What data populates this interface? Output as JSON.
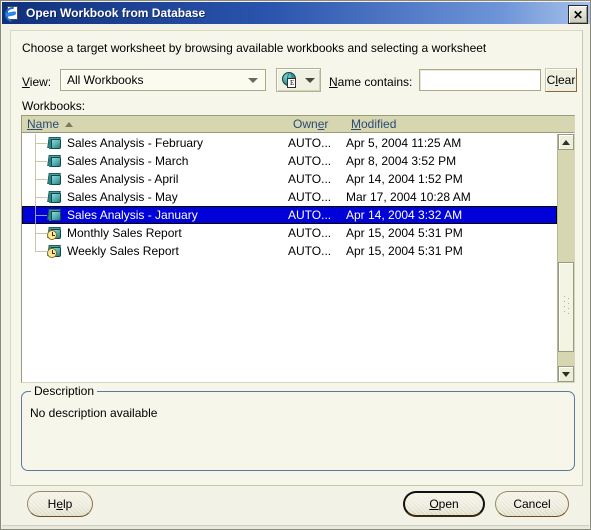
{
  "window": {
    "title": "Open Workbook from Database",
    "icon": "workbook-document-icon",
    "close_label": "✕"
  },
  "instruction": "Choose a target worksheet by browsing available workbooks and selecting a worksheet",
  "filters": {
    "view_label_pre": "V",
    "view_label_post": "iew:",
    "view_value": "All Workbooks",
    "source_button_icon": "globe-document-icon",
    "name_label_pre": "N",
    "name_label_post": "ame contains:",
    "name_value": "",
    "name_placeholder": "",
    "clear_label_pre": "C",
    "clear_label_mid": "l",
    "clear_label_post": "ear"
  },
  "list": {
    "section_label": "Workbooks:",
    "columns": [
      {
        "key": "name",
        "label_pre": "N",
        "label_mn": "a",
        "label_post": "me",
        "sort": "ascending"
      },
      {
        "key": "owner",
        "label_pre": "Own",
        "label_mn": "e",
        "label_post": "r",
        "sort": "none"
      },
      {
        "key": "modified",
        "label_pre": "",
        "label_mn": "M",
        "label_post": "odified",
        "sort": "none"
      }
    ],
    "rows": [
      {
        "name": "Sales Analysis - February",
        "owner": "AUTO...",
        "modified": "Apr 5, 2004 11:25 AM",
        "icon": "workbook-book-icon",
        "selected": false
      },
      {
        "name": "Sales Analysis - March",
        "owner": "AUTO...",
        "modified": "Apr 8, 2004 3:52 PM",
        "icon": "workbook-book-icon",
        "selected": false
      },
      {
        "name": "Sales Analysis - April",
        "owner": "AUTO...",
        "modified": "Apr 14, 2004 1:52 PM",
        "icon": "workbook-book-icon",
        "selected": false
      },
      {
        "name": "Sales Analysis - May",
        "owner": "AUTO...",
        "modified": "Mar 17, 2004 10:28 AM",
        "icon": "workbook-book-icon",
        "selected": false
      },
      {
        "name": "Sales Analysis - January",
        "owner": "AUTO...",
        "modified": "Apr 14, 2004 3:32 AM",
        "icon": "workbook-book-icon",
        "selected": true
      },
      {
        "name": "Monthly Sales Report",
        "owner": "AUTO...",
        "modified": "Apr 15, 2004 5:31 PM",
        "icon": "scheduled-report-clock-icon",
        "selected": false
      },
      {
        "name": "Weekly Sales Report",
        "owner": "AUTO...",
        "modified": "Apr 15, 2004 5:31 PM",
        "icon": "scheduled-report-clock-icon",
        "selected": false
      }
    ]
  },
  "description": {
    "legend": "Description",
    "text": "No description available"
  },
  "buttons": {
    "help_pre": "H",
    "help_mn": "e",
    "help_post": "lp",
    "open_pre": "",
    "open_mn": "O",
    "open_post": "pen",
    "cancel_label": "Cancel"
  },
  "colors": {
    "titlebar_start": "#10307c",
    "titlebar_end": "#a8c2ea",
    "dialog_bg": "#f2f2e6",
    "panel_bg": "#f6f6ea",
    "list_header_bg": "#d6d6b0",
    "selection_bg": "#0000d8",
    "header_text": "#2a4a78",
    "group_border": "#5d7a9c"
  }
}
